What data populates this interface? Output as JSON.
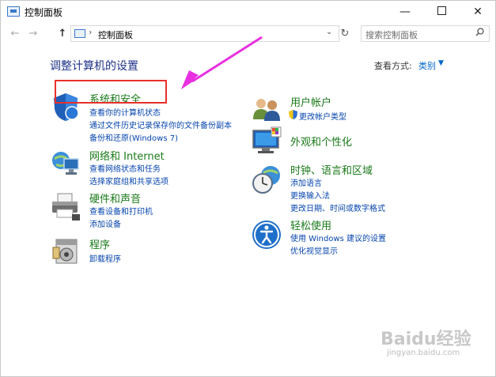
{
  "window": {
    "title": "控制面板"
  },
  "controls": {
    "minimize": "—",
    "close": "✕"
  },
  "nav": {
    "back": "←",
    "forward": "→",
    "up": "↑",
    "refresh": "↻"
  },
  "address": {
    "separator": "›",
    "path": "控制面板",
    "dropdown": "⌄"
  },
  "search": {
    "placeholder": "搜索控制面板",
    "icon": "search-icon"
  },
  "heading": "调整计算机的设置",
  "view_by": {
    "label": "查看方式:",
    "value": "类别",
    "arrow": "▼"
  },
  "categories_left": [
    {
      "title": "系统和安全",
      "links": [
        "查看你的计算机状态",
        "通过文件历史记录保存你的文件备份副本",
        "备份和还原(Windows 7)"
      ],
      "icon": "shield-icon"
    },
    {
      "title": "网络和 Internet",
      "links": [
        "查看网络状态和任务",
        "选择家庭组和共享选项"
      ],
      "icon": "network-globe-icon"
    },
    {
      "title": "硬件和声音",
      "links": [
        "查看设备和打印机",
        "添加设备"
      ],
      "icon": "printer-icon"
    },
    {
      "title": "程序",
      "links": [
        "卸载程序"
      ],
      "icon": "programs-icon"
    }
  ],
  "categories_right": [
    {
      "title": "用户帐户",
      "links": [
        "更改帐户类型"
      ],
      "icon": "users-icon",
      "link_icon": "uac-shield-icon"
    },
    {
      "title": "外观和个性化",
      "links": [],
      "icon": "display-icon"
    },
    {
      "title": "时钟、语言和区域",
      "links": [
        "添加语言",
        "更换输入法",
        "更改日期、时间或数字格式"
      ],
      "icon": "clock-globe-icon"
    },
    {
      "title": "轻松使用",
      "links": [
        "使用 Windows 建议的设置",
        "优化视觉显示"
      ],
      "icon": "accessibility-icon"
    }
  ],
  "annotation": {
    "highlight_color": "#e8302a",
    "arrow_color": "#e830e0"
  },
  "watermark": {
    "text": "Baidu经验",
    "sub": "jingyan.baidu.com"
  }
}
